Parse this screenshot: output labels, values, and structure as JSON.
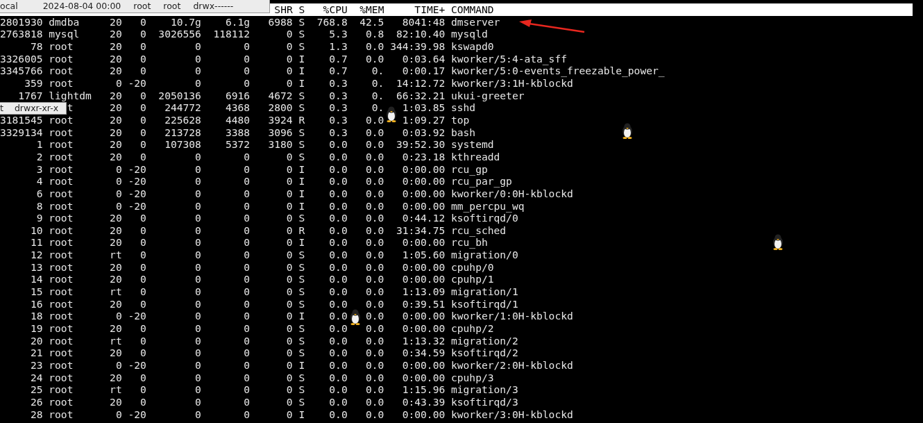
{
  "table": {
    "columns": [
      {
        "label": "SHR"
      },
      {
        "label": "S"
      },
      {
        "label": "%CPU"
      },
      {
        "label": "%MEM"
      },
      {
        "label": "TIME+"
      },
      {
        "label": "COMMAND"
      }
    ],
    "rows": [
      {
        "pid": "2801930",
        "user": "dmdba",
        "pr": "20",
        "ni": "0",
        "virt": "10.7g",
        "res": "6.1g",
        "shr": "6988",
        "s": "S",
        "cpu": "768.8",
        "mem": "42.5",
        "time": "8041:48",
        "command": "dmserver"
      },
      {
        "pid": "2763818",
        "user": "mysql",
        "pr": "20",
        "ni": "0",
        "virt": "3026556",
        "res": "118112",
        "shr": "0",
        "s": "S",
        "cpu": "5.3",
        "mem": "0.8",
        "time": "82:10.40",
        "command": "mysqld"
      },
      {
        "pid": "78",
        "user": "root",
        "pr": "20",
        "ni": "0",
        "virt": "0",
        "res": "0",
        "shr": "0",
        "s": "S",
        "cpu": "1.3",
        "mem": "0.0",
        "time": "344:39.98",
        "command": "kswapd0"
      },
      {
        "pid": "3326005",
        "user": "root",
        "pr": "20",
        "ni": "0",
        "virt": "0",
        "res": "0",
        "shr": "0",
        "s": "I",
        "cpu": "0.7",
        "mem": "0.0",
        "time": "0:03.64",
        "command": "kworker/5:4-ata_sff"
      },
      {
        "pid": "3345766",
        "user": "root",
        "pr": "20",
        "ni": "0",
        "virt": "0",
        "res": "0",
        "shr": "0",
        "s": "I",
        "cpu": "0.7",
        "mem": "0.",
        "time": "0:00.17",
        "command": "kworker/5:0-events_freezable_power_"
      },
      {
        "pid": "359",
        "user": "root",
        "pr": "0",
        "ni": "-20",
        "virt": "0",
        "res": "0",
        "shr": "0",
        "s": "I",
        "cpu": "0.3",
        "mem": "0.",
        "time": "14:12.72",
        "command": "kworker/3:1H-kblockd"
      },
      {
        "pid": "1767",
        "user": "lightdm",
        "pr": "20",
        "ni": "0",
        "virt": "2050136",
        "res": "6916",
        "shr": "4672",
        "s": "S",
        "cpu": "0.3",
        "mem": "0.",
        "time": "66:32.21",
        "command": "ukui-greeter"
      },
      {
        "user": "t",
        "pr": "20",
        "ni": "0",
        "virt": "244772",
        "res": "4368",
        "shr": "2800",
        "s": "S",
        "cpu": "0.3",
        "mem": "0.",
        "time": "1:03.85",
        "command": "sshd"
      },
      {
        "pid": "3181545",
        "user": "root",
        "pr": "20",
        "ni": "0",
        "virt": "225628",
        "res": "4480",
        "shr": "3924",
        "s": "R",
        "cpu": "0.3",
        "mem": "0.0",
        "time": "1:09.27",
        "command": "top"
      },
      {
        "pid": "3329134",
        "user": "root",
        "pr": "20",
        "ni": "0",
        "virt": "213728",
        "res": "3388",
        "shr": "3096",
        "s": "S",
        "cpu": "0.3",
        "mem": "0.0",
        "time": "0:03.92",
        "command": "bash"
      },
      {
        "pid": "1",
        "user": "root",
        "pr": "20",
        "ni": "0",
        "virt": "107308",
        "res": "5372",
        "shr": "3180",
        "s": "S",
        "cpu": "0.0",
        "mem": "0.0",
        "time": "39:52.30",
        "command": "systemd"
      },
      {
        "pid": "2",
        "user": "root",
        "pr": "20",
        "ni": "0",
        "virt": "0",
        "res": "0",
        "shr": "0",
        "s": "S",
        "cpu": "0.0",
        "mem": "0.0",
        "time": "0:23.18",
        "command": "kthreadd"
      },
      {
        "pid": "3",
        "user": "root",
        "pr": "0",
        "ni": "-20",
        "virt": "0",
        "res": "0",
        "shr": "0",
        "s": "I",
        "cpu": "0.0",
        "mem": "0.0",
        "time": "0:00.00",
        "command": "rcu_gp"
      },
      {
        "pid": "4",
        "user": "root",
        "pr": "0",
        "ni": "-20",
        "virt": "0",
        "res": "0",
        "shr": "0",
        "s": "I",
        "cpu": "0.0",
        "mem": "0.0",
        "time": "0:00.00",
        "command": "rcu_par_gp"
      },
      {
        "pid": "6",
        "user": "root",
        "pr": "0",
        "ni": "-20",
        "virt": "0",
        "res": "0",
        "shr": "0",
        "s": "I",
        "cpu": "0.0",
        "mem": "0.0",
        "time": "0:00.00",
        "command": "kworker/0:0H-kblockd"
      },
      {
        "pid": "8",
        "user": "root",
        "pr": "0",
        "ni": "-20",
        "virt": "0",
        "res": "0",
        "shr": "0",
        "s": "I",
        "cpu": "0.0",
        "mem": "0.0",
        "time": "0:00.00",
        "command": "mm_percpu_wq"
      },
      {
        "pid": "9",
        "user": "root",
        "pr": "20",
        "ni": "0",
        "virt": "0",
        "res": "0",
        "shr": "0",
        "s": "S",
        "cpu": "0.0",
        "mem": "0.0",
        "time": "0:44.12",
        "command": "ksoftirqd/0"
      },
      {
        "pid": "10",
        "user": "root",
        "pr": "20",
        "ni": "0",
        "virt": "0",
        "res": "0",
        "shr": "0",
        "s": "R",
        "cpu": "0.0",
        "mem": "0.0",
        "time": "31:34.75",
        "command": "rcu_sched"
      },
      {
        "pid": "11",
        "user": "root",
        "pr": "20",
        "ni": "0",
        "virt": "0",
        "res": "0",
        "shr": "0",
        "s": "I",
        "cpu": "0.0",
        "mem": "0.0",
        "time": "0:00.00",
        "command": "rcu_bh"
      },
      {
        "pid": "12",
        "user": "root",
        "pr": "rt",
        "ni": "0",
        "virt": "0",
        "res": "0",
        "shr": "0",
        "s": "S",
        "cpu": "0.0",
        "mem": "0.0",
        "time": "1:05.60",
        "command": "migration/0"
      },
      {
        "pid": "13",
        "user": "root",
        "pr": "20",
        "ni": "0",
        "virt": "0",
        "res": "0",
        "shr": "0",
        "s": "S",
        "cpu": "0.0",
        "mem": "0.0",
        "time": "0:00.00",
        "command": "cpuhp/0"
      },
      {
        "pid": "14",
        "user": "root",
        "pr": "20",
        "ni": "0",
        "virt": "0",
        "res": "0",
        "shr": "0",
        "s": "S",
        "cpu": "0.0",
        "mem": "0.0",
        "time": "0:00.00",
        "command": "cpuhp/1"
      },
      {
        "pid": "15",
        "user": "root",
        "pr": "rt",
        "ni": "0",
        "virt": "0",
        "res": "0",
        "shr": "0",
        "s": "S",
        "cpu": "0.0",
        "mem": "0.0",
        "time": "1:13.09",
        "command": "migration/1"
      },
      {
        "pid": "16",
        "user": "root",
        "pr": "20",
        "ni": "0",
        "virt": "0",
        "res": "0",
        "shr": "0",
        "s": "S",
        "cpu": "0.0",
        "mem": "0.0",
        "time": "0:39.51",
        "command": "ksoftirqd/1"
      },
      {
        "pid": "18",
        "user": "root",
        "pr": "0",
        "ni": "-20",
        "virt": "0",
        "res": "0",
        "shr": "0",
        "s": "I",
        "cpu": "0.0",
        "mem": "0.0",
        "time": "0:00.00",
        "command": "kworker/1:0H-kblockd"
      },
      {
        "pid": "19",
        "user": "root",
        "pr": "20",
        "ni": "0",
        "virt": "0",
        "res": "0",
        "shr": "0",
        "s": "S",
        "cpu": "0.0",
        "mem": "0.0",
        "time": "0:00.00",
        "command": "cpuhp/2"
      },
      {
        "pid": "20",
        "user": "root",
        "pr": "rt",
        "ni": "0",
        "virt": "0",
        "res": "0",
        "shr": "0",
        "s": "S",
        "cpu": "0.0",
        "mem": "0.0",
        "time": "1:13.32",
        "command": "migration/2"
      },
      {
        "pid": "21",
        "user": "root",
        "pr": "20",
        "ni": "0",
        "virt": "0",
        "res": "0",
        "shr": "0",
        "s": "S",
        "cpu": "0.0",
        "mem": "0.0",
        "time": "0:34.59",
        "command": "ksoftirqd/2"
      },
      {
        "pid": "23",
        "user": "root",
        "pr": "0",
        "ni": "-20",
        "virt": "0",
        "res": "0",
        "shr": "0",
        "s": "I",
        "cpu": "0.0",
        "mem": "0.0",
        "time": "0:00.00",
        "command": "kworker/2:0H-kblockd"
      },
      {
        "pid": "24",
        "user": "root",
        "pr": "20",
        "ni": "0",
        "virt": "0",
        "res": "0",
        "shr": "0",
        "s": "S",
        "cpu": "0.0",
        "mem": "0.0",
        "time": "0:00.00",
        "command": "cpuhp/3"
      },
      {
        "pid": "25",
        "user": "root",
        "pr": "rt",
        "ni": "0",
        "virt": "0",
        "res": "0",
        "shr": "0",
        "s": "S",
        "cpu": "0.0",
        "mem": "0.0",
        "time": "1:15.96",
        "command": "migration/3"
      },
      {
        "pid": "26",
        "user": "root",
        "pr": "20",
        "ni": "0",
        "virt": "0",
        "res": "0",
        "shr": "0",
        "s": "S",
        "cpu": "0.0",
        "mem": "0.0",
        "time": "0:43.39",
        "command": "ksoftirqd/3"
      },
      {
        "pid": "28",
        "user": "root",
        "pr": "0",
        "ni": "-20",
        "virt": "0",
        "res": "0",
        "shr": "0",
        "s": "I",
        "cpu": "0.0",
        "mem": "0.0",
        "time": "0:00.00",
        "command": "kworker/3:0H-kblockd"
      }
    ]
  },
  "tooltips": [
    {
      "texts": [
        "ocal",
        "2024-08-04 00:00",
        "root",
        "root",
        "drwx------"
      ]
    },
    {
      "texts": [
        "t",
        "drwxr-xr-x"
      ]
    }
  ]
}
